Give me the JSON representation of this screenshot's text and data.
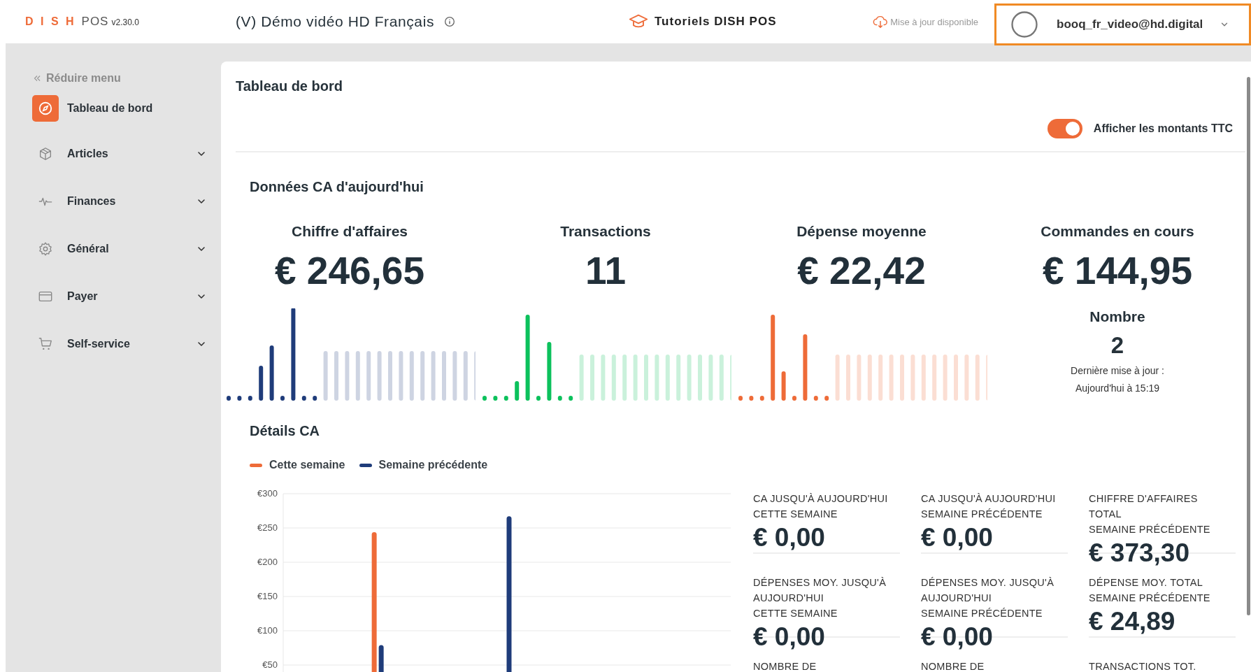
{
  "header": {
    "logo": {
      "brand": "D I S H",
      "product": "POS",
      "version": "v2.30.0"
    },
    "title": "(V) Démo vidéo HD Français",
    "tutorials": "Tutoriels DISH POS",
    "update": "Mise à jour disponible",
    "user": {
      "email": "booq_fr_video@hd.digital",
      "highlighted": true
    }
  },
  "sidebar": {
    "collapse": "Réduire menu",
    "items": [
      {
        "label": "Tableau de bord",
        "selected": true,
        "expandable": false
      },
      {
        "label": "Articles",
        "selected": false,
        "expandable": true
      },
      {
        "label": "Finances",
        "selected": false,
        "expandable": true
      },
      {
        "label": "Général",
        "selected": false,
        "expandable": true
      },
      {
        "label": "Payer",
        "selected": false,
        "expandable": true
      },
      {
        "label": "Self-service",
        "selected": false,
        "expandable": true
      }
    ]
  },
  "page": {
    "title": "Tableau de bord",
    "toggle": {
      "label": "Afficher les montants TTC",
      "on": true
    }
  },
  "today": {
    "title": "Données CA d'aujourd'hui",
    "stats": [
      {
        "label": "Chiffre d'affaires",
        "value": "€ 246,65",
        "color": "#1f3c7a"
      },
      {
        "label": "Transactions",
        "value": "11",
        "color": "#0cc15c"
      },
      {
        "label": "Dépense moyenne",
        "value": "€ 22,42",
        "color": "#ee6b38"
      }
    ],
    "orders": {
      "label": "Commandes en cours",
      "value": "€ 144,95",
      "count_label": "Nombre",
      "count": "2",
      "updated": "Dernière mise à jour :",
      "updated_time": "Aujourd'hui à 15:19"
    }
  },
  "details": {
    "title": "Détails CA",
    "chart_data": {
      "type": "bar",
      "series": [
        {
          "name": "Cette semaine",
          "color": "#ee6b38",
          "values": [
            null,
            244,
            null,
            null,
            null,
            null,
            null
          ]
        },
        {
          "name": "Semaine précédente",
          "color": "#1f3c7a",
          "values": [
            null,
            79,
            null,
            267,
            null,
            null,
            null
          ]
        }
      ],
      "ylim": [
        0,
        300
      ],
      "grid": true,
      "yticks": [
        {
          "value": 300,
          "label": "€300"
        },
        {
          "value": 250,
          "label": "€250"
        },
        {
          "value": 200,
          "label": "€200"
        },
        {
          "value": 150,
          "label": "€150"
        },
        {
          "value": 100,
          "label": "€100"
        },
        {
          "value": 50,
          "label": "€50"
        }
      ]
    },
    "metrics": [
      {
        "label": "CA JUSQU'À AUJOURD'HUI\nCETTE SEMAINE",
        "value": "€ 0,00"
      },
      {
        "label": "CA JUSQU'À AUJOURD'HUI\nSEMAINE PRÉCÉDENTE",
        "value": "€ 0,00"
      },
      {
        "label": "CHIFFRE D'AFFAIRES\nTOTAL\nSEMAINE PRÉCÉDENTE",
        "value": "€ 373,30"
      },
      {
        "label": "DÉPENSES MOY. JUSQU'À\nAUJOURD'HUI\nCETTE SEMAINE",
        "value": "€ 0,00"
      },
      {
        "label": "DÉPENSES MOY. JUSQU'À\nAUJOURD'HUI\nSEMAINE PRÉCÉDENTE",
        "value": "€ 0,00"
      },
      {
        "label": "DÉPENSE MOY. TOTAL\nSEMAINE PRÉCÉDENTE",
        "value": "€ 24,89"
      },
      {
        "label": "NOMBRE DE"
      },
      {
        "label": "NOMBRE DE"
      },
      {
        "label": "TRANSACTIONS TOT."
      }
    ]
  }
}
